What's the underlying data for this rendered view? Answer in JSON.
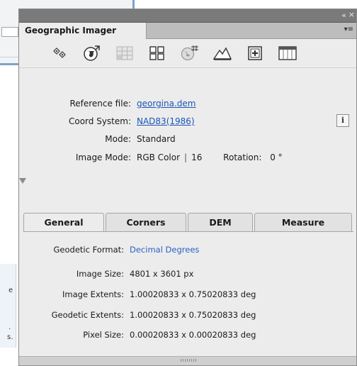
{
  "background": {
    "snippet_right_e": "e",
    "snippet_right_dot": ".",
    "snippet_right_s": "s."
  },
  "panel": {
    "tab_title": "Geographic Imager",
    "collapse_glyph": "«",
    "close_glyph": "×",
    "menu_glyph": "▾≡"
  },
  "toolbar": {
    "icons": [
      "georeference-icon",
      "globe-icon",
      "grid-icon",
      "tile-icon",
      "map-edit-icon",
      "terrain-icon",
      "add-icon",
      "table-icon"
    ]
  },
  "info": {
    "reference_file_label": "Reference file:",
    "reference_file_value": "georgina.dem",
    "coord_system_label": "Coord System:",
    "coord_system_value": "NAD83(1986)",
    "mode_label": "Mode:",
    "mode_value": "Standard",
    "image_mode_label": "Image Mode:",
    "image_mode_value": "RGB Color",
    "bit_depth": "16",
    "rotation_label": "Rotation:",
    "rotation_value": "0 °",
    "info_glyph": "i"
  },
  "tabs": [
    {
      "label": "General",
      "active": true
    },
    {
      "label": "Corners",
      "active": false
    },
    {
      "label": "DEM",
      "active": false
    },
    {
      "label": "Measure",
      "active": false
    }
  ],
  "general": {
    "geodetic_format_label": "Geodetic Format:",
    "geodetic_format_value": "Decimal Degrees",
    "image_size_label": "Image Size:",
    "image_size_value": "4801 x 3601 px",
    "image_extents_label": "Image Extents:",
    "image_extents_value": "1.00020833 x 0.75020833 deg",
    "geodetic_extents_label": "Geodetic Extents:",
    "geodetic_extents_value": "1.00020833 x 0.75020833 deg",
    "pixel_size_label": "Pixel Size:",
    "pixel_size_value": "0.00020833 x 0.00020833 deg"
  },
  "colors": {
    "link": "#1a55b8",
    "panel_bg": "#ececec",
    "titlebar": "#7a7a7a"
  }
}
